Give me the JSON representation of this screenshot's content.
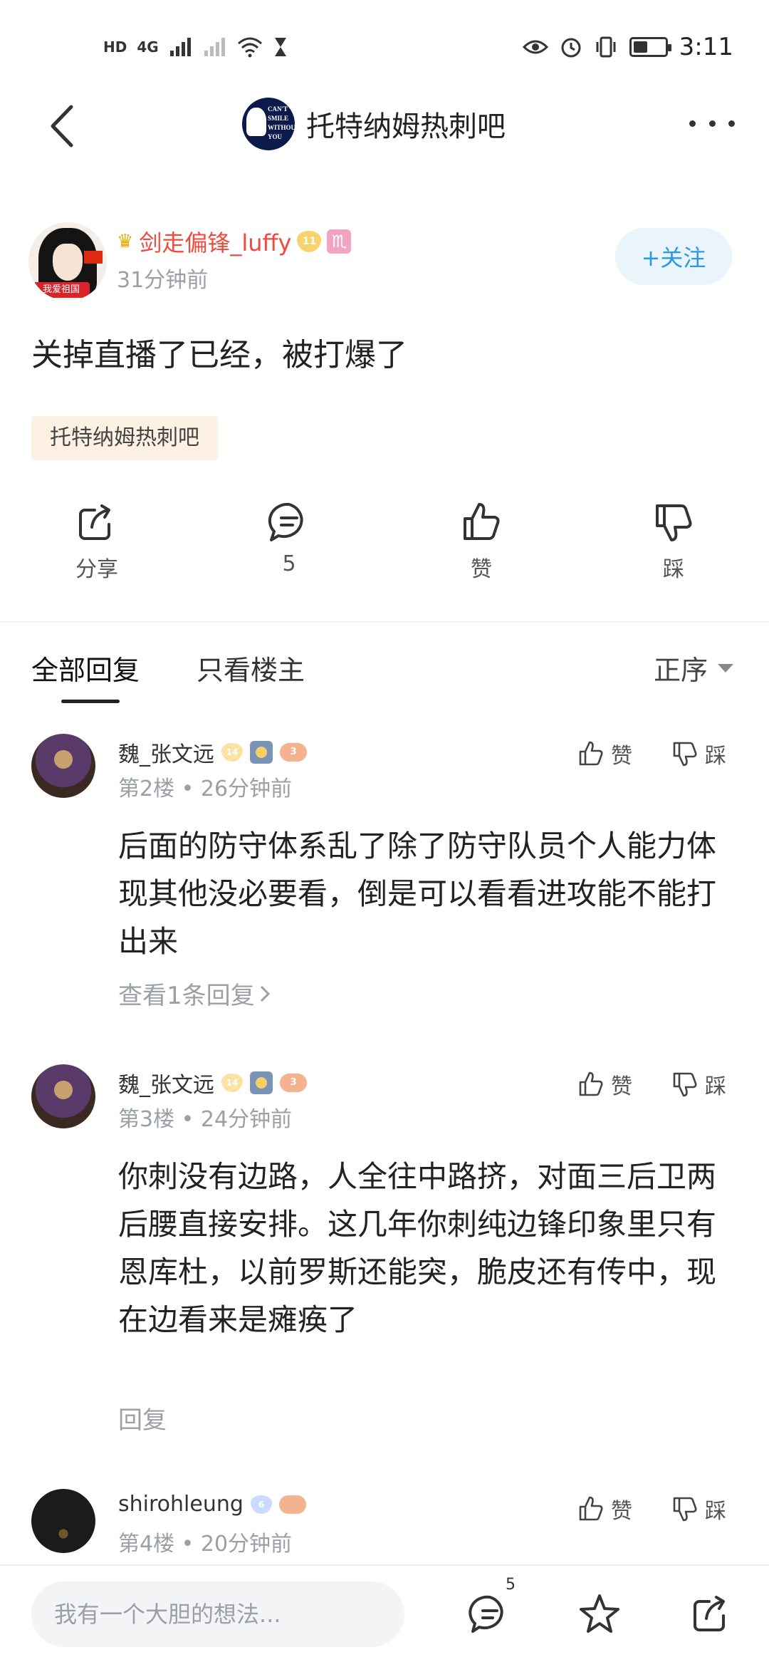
{
  "status_bar": {
    "hd": "HD",
    "network": "4G",
    "time": "3:11",
    "battery_level": 0.4
  },
  "header": {
    "forum_title": "托特纳姆热刺吧",
    "logo_text": [
      "CAN'T",
      "SMILE",
      "WITHOUT",
      "YOU"
    ]
  },
  "post": {
    "author_name": "剑走偏锋_luffy",
    "author_level": "11",
    "zodiac_symbol": "♏",
    "avatar_banner": "我爱祖国",
    "posted_time": "31分钟前",
    "follow_label": "+关注",
    "content": "关掉直播了已经，被打爆了",
    "tag": "托特纳姆热刺吧"
  },
  "actions": {
    "share_label": "分享",
    "comment_count": "5",
    "like_label": "赞",
    "dislike_label": "踩"
  },
  "reply_tabs": {
    "all_label": "全部回复",
    "op_only_label": "只看楼主",
    "sort_label": "正序"
  },
  "comments": [
    {
      "name": "魏_张文远",
      "level": "14",
      "game_level": "3",
      "floor": "第2楼",
      "time": "26分钟前",
      "text": "后面的防守体系乱了除了防守队员个人能力体现其他没必要看，倒是可以看看进攻能不能打出来",
      "sub_link": "查看1条回复",
      "like_label": "赞",
      "dislike_label": "踩"
    },
    {
      "name": "魏_张文远",
      "level": "14",
      "game_level": "3",
      "floor": "第3楼",
      "time": "24分钟前",
      "text": "你刺没有边路，人全往中路挤，对面三后卫两后腰直接安排。这几年你刺纯边锋印象里只有恩库杜，以前罗斯还能突，脆皮还有传中，现在边看来是瘫痪了",
      "sub_link": "回复",
      "like_label": "赞",
      "dislike_label": "踩"
    },
    {
      "name": "shirohleung",
      "level": "6",
      "game_level": "",
      "floor": "第4楼",
      "time": "20分钟前",
      "text": "",
      "sub_link": "",
      "like_label": "赞",
      "dislike_label": "踩"
    }
  ],
  "bottom_bar": {
    "input_placeholder": "我有一个大胆的想法...",
    "comment_count": "5"
  },
  "colors": {
    "accent_blue": "#2a9ae2",
    "author_red": "#f04a3c",
    "meta_gray": "#9aa0a6"
  }
}
